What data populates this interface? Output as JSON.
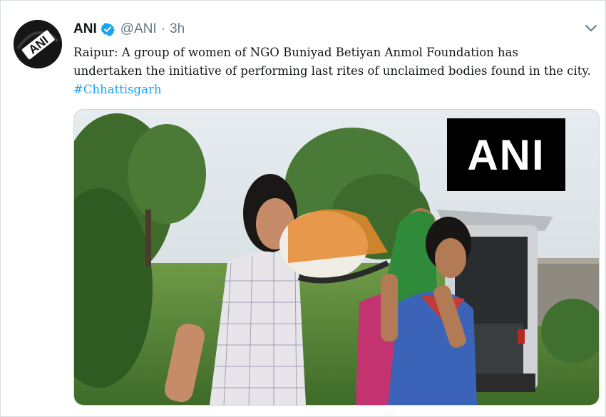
{
  "tweet": {
    "author_name": "ANI",
    "handle": "@ANI",
    "separator": "·",
    "time": "3h",
    "text_line1": "Raipur: A group of women of NGO Buniyad Betiyan Anmol Foundation has",
    "text_line2": "undertaken the initiative of performing last rites of unclaimed bodies found in the city.",
    "hashtag": "#Chhattisgarh",
    "watermark": "ANI"
  },
  "icons": {
    "avatar": "ani-logo-avatar",
    "verified": "verified-badge-icon",
    "menu": "chevron-down-icon"
  },
  "colors": {
    "link": "#1da1f2",
    "muted": "#657786",
    "text": "#14171a",
    "border": "#d9dde0"
  }
}
